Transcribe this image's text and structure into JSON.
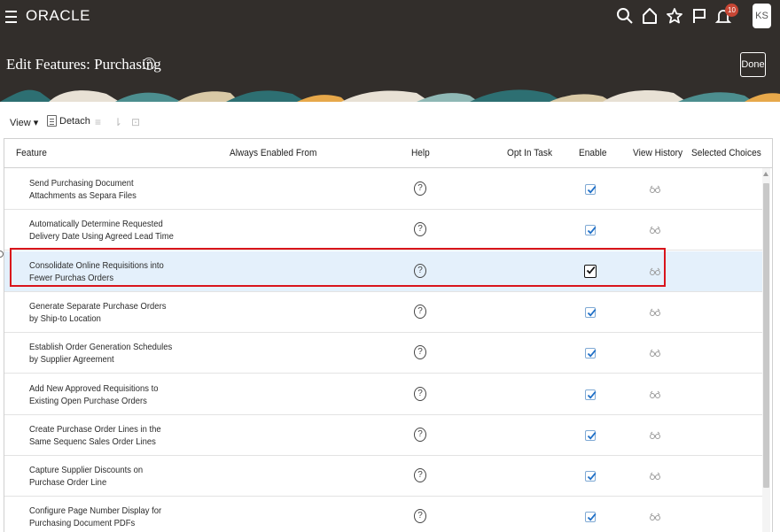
{
  "header": {
    "logo": "ORACLE",
    "title": "Edit Features: Purchasing",
    "notification_count": "10",
    "user_initials": "KS",
    "done_label": "Done",
    "icons": [
      "search-icon",
      "home-icon",
      "star-icon",
      "flag-icon",
      "bell-icon"
    ]
  },
  "toolbar": {
    "view_label": "View ▾",
    "detach_label": "Detach"
  },
  "table": {
    "columns": [
      "Feature",
      "Always Enabled From",
      "Help",
      "Opt In Task",
      "Enable",
      "View History",
      "Selected Choices"
    ],
    "rows": [
      {
        "feature": "Send Purchasing Document Attachments as Separa Files",
        "enabled": true
      },
      {
        "feature": "Automatically Determine Requested Delivery Date Using Agreed Lead Time",
        "enabled": true
      },
      {
        "feature": "Consolidate Online Requisitions into Fewer Purchas Orders",
        "enabled": true,
        "selected": true
      },
      {
        "feature": "Generate Separate Purchase Orders by Ship-to Location",
        "enabled": true
      },
      {
        "feature": "Establish Order Generation Schedules by Supplier Agreement",
        "enabled": true
      },
      {
        "feature": "Add New Approved Requisitions to Existing Open Purchase Orders",
        "enabled": true
      },
      {
        "feature": "Create Purchase Order Lines in the Same Sequenc Sales Order Lines",
        "enabled": true
      },
      {
        "feature": "Capture Supplier Discounts on Purchase Order Line",
        "enabled": true
      },
      {
        "feature": "Configure Page Number Display for Purchasing Document PDFs",
        "enabled": true
      }
    ]
  },
  "colors": {
    "header_bg": "#322e2b",
    "badge": "#c74634",
    "selected_row": "#e4f0fb",
    "highlight_border": "#d9141b",
    "checkbox_check": "#1e6fc7"
  }
}
